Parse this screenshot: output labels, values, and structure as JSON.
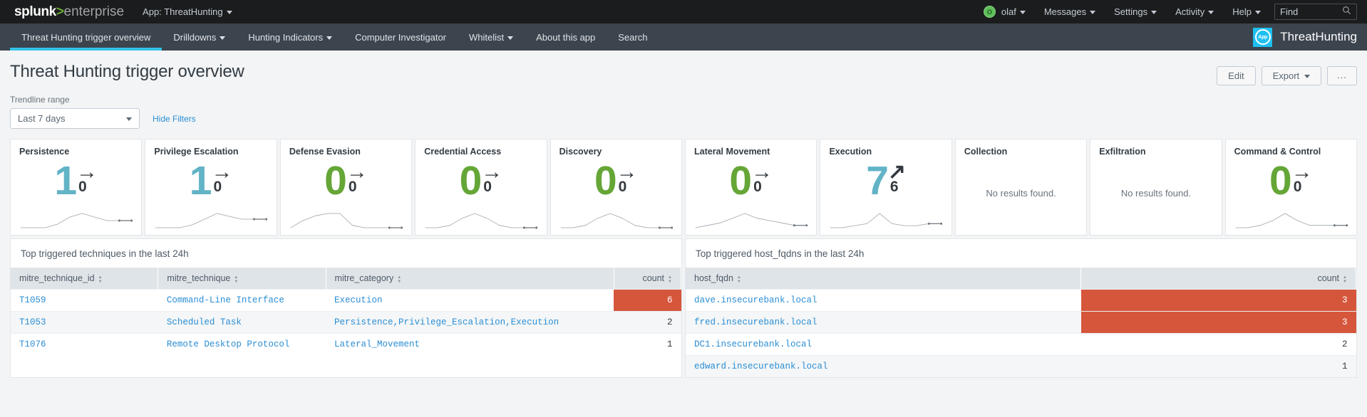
{
  "topbar": {
    "logo": {
      "part1": "splunk",
      "part2": ">",
      "part3": "enterprise"
    },
    "app_menu": "App: ThreatHunting",
    "user": "olaf",
    "user_initial": "O",
    "messages": "Messages",
    "settings": "Settings",
    "activity": "Activity",
    "help": "Help",
    "find_placeholder": "Find"
  },
  "nav": {
    "items": [
      {
        "label": "Threat Hunting trigger overview",
        "active": true,
        "caret": false
      },
      {
        "label": "Drilldowns",
        "active": false,
        "caret": true
      },
      {
        "label": "Hunting Indicators",
        "active": false,
        "caret": true
      },
      {
        "label": "Computer Investigator",
        "active": false,
        "caret": false
      },
      {
        "label": "Whitelist",
        "active": false,
        "caret": true
      },
      {
        "label": "About this app",
        "active": false,
        "caret": false
      },
      {
        "label": "Search",
        "active": false,
        "caret": false
      }
    ],
    "app_badge": "App",
    "app_name": "ThreatHunting"
  },
  "header": {
    "title": "Threat Hunting trigger overview",
    "edit_label": "Edit",
    "export_label": "Export",
    "more_label": "..."
  },
  "filters": {
    "trendline_label": "Trendline range",
    "range_value": "Last 7 days",
    "hide_filters": "Hide Filters"
  },
  "colors": {
    "teal": "#62b3c6",
    "green": "#65a637",
    "dark": "#33393f",
    "heat": "#d6563c",
    "accent": "#33c2e8"
  },
  "kpis": [
    {
      "title": "Persistence",
      "value": "1",
      "value_color": "#62b3c6",
      "delta": "0",
      "arrow": "right",
      "empty": null,
      "spark": [
        3,
        3,
        3,
        4,
        6,
        7,
        6,
        5,
        5,
        5
      ]
    },
    {
      "title": "Privilege Escalation",
      "value": "1",
      "value_color": "#62b3c6",
      "delta": "0",
      "arrow": "right",
      "empty": null,
      "spark": [
        2,
        2,
        2,
        3,
        5,
        7,
        6,
        5,
        5,
        5
      ]
    },
    {
      "title": "Defense Evasion",
      "value": "0",
      "value_color": "#65a637",
      "delta": "0",
      "arrow": "right",
      "empty": null,
      "spark": [
        2,
        5,
        7,
        8,
        8,
        3,
        2,
        2,
        2,
        2
      ]
    },
    {
      "title": "Credential Access",
      "value": "0",
      "value_color": "#65a637",
      "delta": "0",
      "arrow": "right",
      "empty": null,
      "spark": [
        2,
        2,
        3,
        6,
        8,
        6,
        3,
        2,
        2,
        2
      ]
    },
    {
      "title": "Discovery",
      "value": "0",
      "value_color": "#65a637",
      "delta": "0",
      "arrow": "right",
      "empty": null,
      "spark": [
        2,
        2,
        3,
        6,
        8,
        6,
        3,
        2,
        2,
        2
      ]
    },
    {
      "title": "Lateral Movement",
      "value": "0",
      "value_color": "#65a637",
      "delta": "0",
      "arrow": "right",
      "empty": null,
      "spark": [
        2,
        3,
        4,
        6,
        8,
        6,
        5,
        4,
        3,
        3
      ]
    },
    {
      "title": "Execution",
      "value": "7",
      "value_color": "#62b3c6",
      "delta": "6",
      "arrow": "up",
      "empty": null,
      "spark": [
        2,
        2,
        3,
        4,
        9,
        4,
        3,
        3,
        4,
        4
      ]
    },
    {
      "title": "Collection",
      "value": null,
      "value_color": null,
      "delta": null,
      "arrow": null,
      "empty": "No results found.",
      "spark": null
    },
    {
      "title": "Exfiltration",
      "value": null,
      "value_color": null,
      "delta": null,
      "arrow": null,
      "empty": "No results found.",
      "spark": null
    },
    {
      "title": "Command & Control",
      "value": "0",
      "value_color": "#65a637",
      "delta": "0",
      "arrow": "right",
      "empty": null,
      "spark": [
        2,
        2,
        3,
        5,
        8,
        5,
        3,
        3,
        3,
        3
      ]
    }
  ],
  "table_left": {
    "title": "Top triggered techniques in the last 24h",
    "columns": [
      "mitre_technique_id",
      "mitre_technique",
      "mitre_category",
      "count"
    ],
    "rows": [
      {
        "cells": [
          "T1059",
          "Command-Line Interface",
          "Execution",
          "6"
        ],
        "heat": true
      },
      {
        "cells": [
          "T1053",
          "Scheduled Task",
          "Persistence,Privilege_Escalation,Execution",
          "2"
        ],
        "heat": false
      },
      {
        "cells": [
          "T1076",
          "Remote Desktop Protocol",
          "Lateral_Movement",
          "1"
        ],
        "heat": false
      }
    ]
  },
  "table_right": {
    "title": "Top triggered host_fqdns in the last 24h",
    "columns": [
      "host_fqdn",
      "count"
    ],
    "rows": [
      {
        "cells": [
          "dave.insecurebank.local",
          "3"
        ],
        "heat": true
      },
      {
        "cells": [
          "fred.insecurebank.local",
          "3"
        ],
        "heat": true
      },
      {
        "cells": [
          "DC1.insecurebank.local",
          "2"
        ],
        "heat": false
      },
      {
        "cells": [
          "edward.insecurebank.local",
          "1"
        ],
        "heat": false
      }
    ]
  }
}
